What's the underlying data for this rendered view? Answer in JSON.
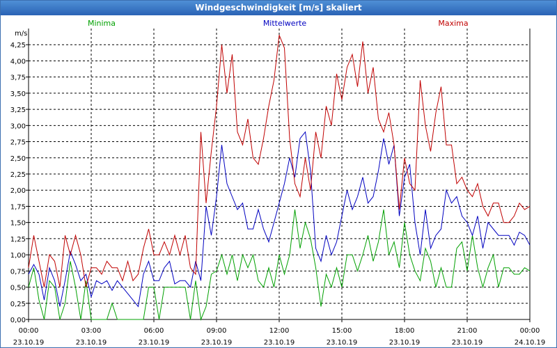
{
  "window": {
    "title": "Windgeschwindigkeit [m/s] skaliert"
  },
  "chart_data": {
    "type": "line",
    "title": "Windgeschwindigkeit [m/s] skaliert",
    "ylabel": "m/s",
    "ylim": [
      0,
      4.5
    ],
    "y_ticks": [
      "0,00",
      "0,25",
      "0,50",
      "0,75",
      "1,00",
      "1,25",
      "1,50",
      "1,75",
      "2,00",
      "2,25",
      "2,50",
      "2,75",
      "3,00",
      "3,25",
      "3,50",
      "3,75",
      "4,00",
      "4,25"
    ],
    "x_ticks": [
      {
        "time": "00:00",
        "date": "23.10.19"
      },
      {
        "time": "03:00",
        "date": "23.10.19"
      },
      {
        "time": "06:00",
        "date": "23.10.19"
      },
      {
        "time": "09:00",
        "date": "23.10.19"
      },
      {
        "time": "12:00",
        "date": "23.10.19"
      },
      {
        "time": "15:00",
        "date": "23.10.19"
      },
      {
        "time": "18:00",
        "date": "23.10.19"
      },
      {
        "time": "21:00",
        "date": "23.10.19"
      },
      {
        "time": "00:00",
        "date": "24.10.19"
      }
    ],
    "x_range_hours": [
      0,
      24
    ],
    "grid": true,
    "legend": "top",
    "series": [
      {
        "name": "Minima",
        "color": "#00a000",
        "x": [
          0,
          0.25,
          0.5,
          0.75,
          1,
          1.25,
          1.5,
          1.75,
          2,
          2.25,
          2.5,
          2.75,
          3,
          3.25,
          3.5,
          3.75,
          4,
          4.25,
          4.5,
          4.75,
          5,
          5.25,
          5.5,
          5.75,
          6,
          6.25,
          6.5,
          6.75,
          7,
          7.25,
          7.5,
          7.75,
          8,
          8.25,
          8.5,
          8.75,
          9,
          9.25,
          9.5,
          9.75,
          10,
          10.25,
          10.5,
          10.75,
          11,
          11.25,
          11.5,
          11.75,
          12,
          12.25,
          12.5,
          12.75,
          13,
          13.25,
          13.5,
          13.75,
          14,
          14.25,
          14.5,
          14.75,
          15,
          15.25,
          15.5,
          15.75,
          16,
          16.25,
          16.5,
          16.75,
          17,
          17.25,
          17.5,
          17.75,
          18,
          18.25,
          18.5,
          18.75,
          19,
          19.25,
          19.5,
          19.75,
          20,
          20.25,
          20.5,
          20.75,
          21,
          21.25,
          21.5,
          21.75,
          22,
          22.25,
          22.5,
          22.75,
          23,
          23.25,
          23.5,
          23.75,
          24
        ],
        "y": [
          0.5,
          0.8,
          0.3,
          0,
          0.6,
          0.5,
          0,
          0.25,
          0.9,
          0.5,
          0,
          0.6,
          0,
          0,
          0,
          0,
          0.25,
          0,
          0,
          0,
          0,
          0,
          0,
          0.5,
          0.5,
          0,
          0.5,
          0.5,
          0.5,
          0.5,
          0.5,
          0,
          0.6,
          0,
          0.2,
          0.7,
          0.75,
          1.0,
          0.7,
          1.0,
          0.6,
          1.0,
          0.8,
          1.0,
          0.6,
          0.5,
          0.8,
          0.5,
          1.0,
          0.7,
          1.0,
          1.7,
          1.1,
          1.5,
          1.25,
          0.8,
          0.2,
          0.7,
          0.5,
          0.8,
          0.5,
          1.0,
          1.0,
          0.75,
          1.0,
          1.3,
          0.9,
          1.2,
          1.7,
          1.0,
          1.2,
          0.8,
          1.5,
          1.0,
          0.75,
          0.6,
          1.1,
          0.9,
          0.5,
          0.8,
          0.5,
          0.5,
          1.1,
          1.2,
          0.75,
          1.3,
          0.8,
          0.5,
          0.8,
          1.0,
          0.5,
          0.8,
          0.8,
          0.7,
          0.7,
          0.8,
          0.75
        ]
      },
      {
        "name": "Mittelwerte",
        "color": "#0000c0",
        "x": [
          0,
          0.25,
          0.5,
          0.75,
          1,
          1.25,
          1.5,
          1.75,
          2,
          2.25,
          2.5,
          2.75,
          3,
          3.25,
          3.5,
          3.75,
          4,
          4.25,
          4.5,
          4.75,
          5,
          5.25,
          5.5,
          5.75,
          6,
          6.25,
          6.5,
          6.75,
          7,
          7.25,
          7.5,
          7.75,
          8,
          8.25,
          8.5,
          8.75,
          9,
          9.25,
          9.5,
          9.75,
          10,
          10.25,
          10.5,
          10.75,
          11,
          11.25,
          11.5,
          11.75,
          12,
          12.25,
          12.5,
          12.75,
          13,
          13.25,
          13.5,
          13.75,
          14,
          14.25,
          14.5,
          14.75,
          15,
          15.25,
          15.5,
          15.75,
          16,
          16.25,
          16.5,
          16.75,
          17,
          17.25,
          17.5,
          17.75,
          18,
          18.25,
          18.5,
          18.75,
          19,
          19.25,
          19.5,
          19.75,
          20,
          20.25,
          20.5,
          20.75,
          21,
          21.25,
          21.5,
          21.75,
          22,
          22.25,
          22.5,
          22.75,
          23,
          23.25,
          23.5,
          23.75,
          24
        ],
        "y": [
          0.7,
          0.85,
          0.7,
          0.3,
          0.8,
          0.6,
          0.2,
          0.6,
          1.05,
          0.85,
          0.6,
          0.7,
          0.35,
          0.6,
          0.55,
          0.6,
          0.45,
          0.6,
          0.5,
          0.4,
          0.3,
          0.2,
          0.7,
          0.9,
          0.6,
          0.6,
          0.8,
          0.9,
          0.55,
          0.6,
          0.6,
          0.5,
          0.9,
          0.6,
          1.75,
          1.3,
          1.9,
          2.7,
          2.1,
          1.9,
          1.7,
          1.8,
          1.4,
          1.4,
          1.7,
          1.4,
          1.2,
          1.5,
          1.8,
          2.1,
          2.5,
          2.2,
          2.8,
          2.9,
          2.3,
          1.1,
          0.9,
          1.3,
          1.0,
          1.2,
          1.6,
          2.0,
          1.7,
          1.9,
          2.2,
          1.8,
          1.9,
          2.3,
          2.8,
          2.4,
          2.7,
          1.6,
          2.2,
          2.4,
          1.5,
          1.0,
          1.7,
          1.1,
          1.3,
          1.4,
          2.0,
          1.8,
          1.9,
          1.6,
          1.5,
          1.3,
          1.6,
          1.1,
          1.5,
          1.4,
          1.3,
          1.3,
          1.3,
          1.15,
          1.35,
          1.3,
          1.15
        ]
      },
      {
        "name": "Maxima",
        "color": "#c00000",
        "x": [
          0,
          0.25,
          0.5,
          0.75,
          1,
          1.25,
          1.5,
          1.75,
          2,
          2.25,
          2.5,
          2.75,
          3,
          3.25,
          3.5,
          3.75,
          4,
          4.25,
          4.5,
          4.75,
          5,
          5.25,
          5.5,
          5.75,
          6,
          6.25,
          6.5,
          6.75,
          7,
          7.25,
          7.5,
          7.75,
          8,
          8.25,
          8.5,
          8.75,
          9,
          9.25,
          9.5,
          9.75,
          10,
          10.25,
          10.5,
          10.75,
          11,
          11.25,
          11.5,
          11.75,
          12,
          12.25,
          12.5,
          12.75,
          13,
          13.25,
          13.5,
          13.75,
          14,
          14.25,
          14.5,
          14.75,
          15,
          15.25,
          15.5,
          15.75,
          16,
          16.25,
          16.5,
          16.75,
          17,
          17.25,
          17.5,
          17.75,
          18,
          18.25,
          18.5,
          18.75,
          19,
          19.25,
          19.5,
          19.75,
          20,
          20.25,
          20.5,
          20.75,
          21,
          21.25,
          21.5,
          21.75,
          22,
          22.25,
          22.5,
          22.75,
          23,
          23.25,
          23.5,
          23.75,
          24
        ],
        "y": [
          0.8,
          1.3,
          0.9,
          0.5,
          1.0,
          0.9,
          0.5,
          1.3,
          1.0,
          1.3,
          1.0,
          0.5,
          0.8,
          0.8,
          0.7,
          0.9,
          0.8,
          0.8,
          0.6,
          0.9,
          0.6,
          0.7,
          1.1,
          1.4,
          1.0,
          1.0,
          1.2,
          1.0,
          1.3,
          1.0,
          1.3,
          0.8,
          0.7,
          2.9,
          1.8,
          2.6,
          3.3,
          4.25,
          3.5,
          4.1,
          2.9,
          2.7,
          3.1,
          2.5,
          2.4,
          2.8,
          3.3,
          3.7,
          4.4,
          4.2,
          2.8,
          2.1,
          1.9,
          2.5,
          2.0,
          2.9,
          2.5,
          3.3,
          3.0,
          3.8,
          3.4,
          3.9,
          4.1,
          3.6,
          4.3,
          3.5,
          3.9,
          3.1,
          2.9,
          3.2,
          2.7,
          1.7,
          2.5,
          2.1,
          2.0,
          3.7,
          3.0,
          2.6,
          3.2,
          3.6,
          2.7,
          2.7,
          2.1,
          2.2,
          2.0,
          1.9,
          2.1,
          1.75,
          1.6,
          1.8,
          1.8,
          1.5,
          1.5,
          1.6,
          1.8,
          1.7,
          1.75
        ]
      }
    ]
  }
}
